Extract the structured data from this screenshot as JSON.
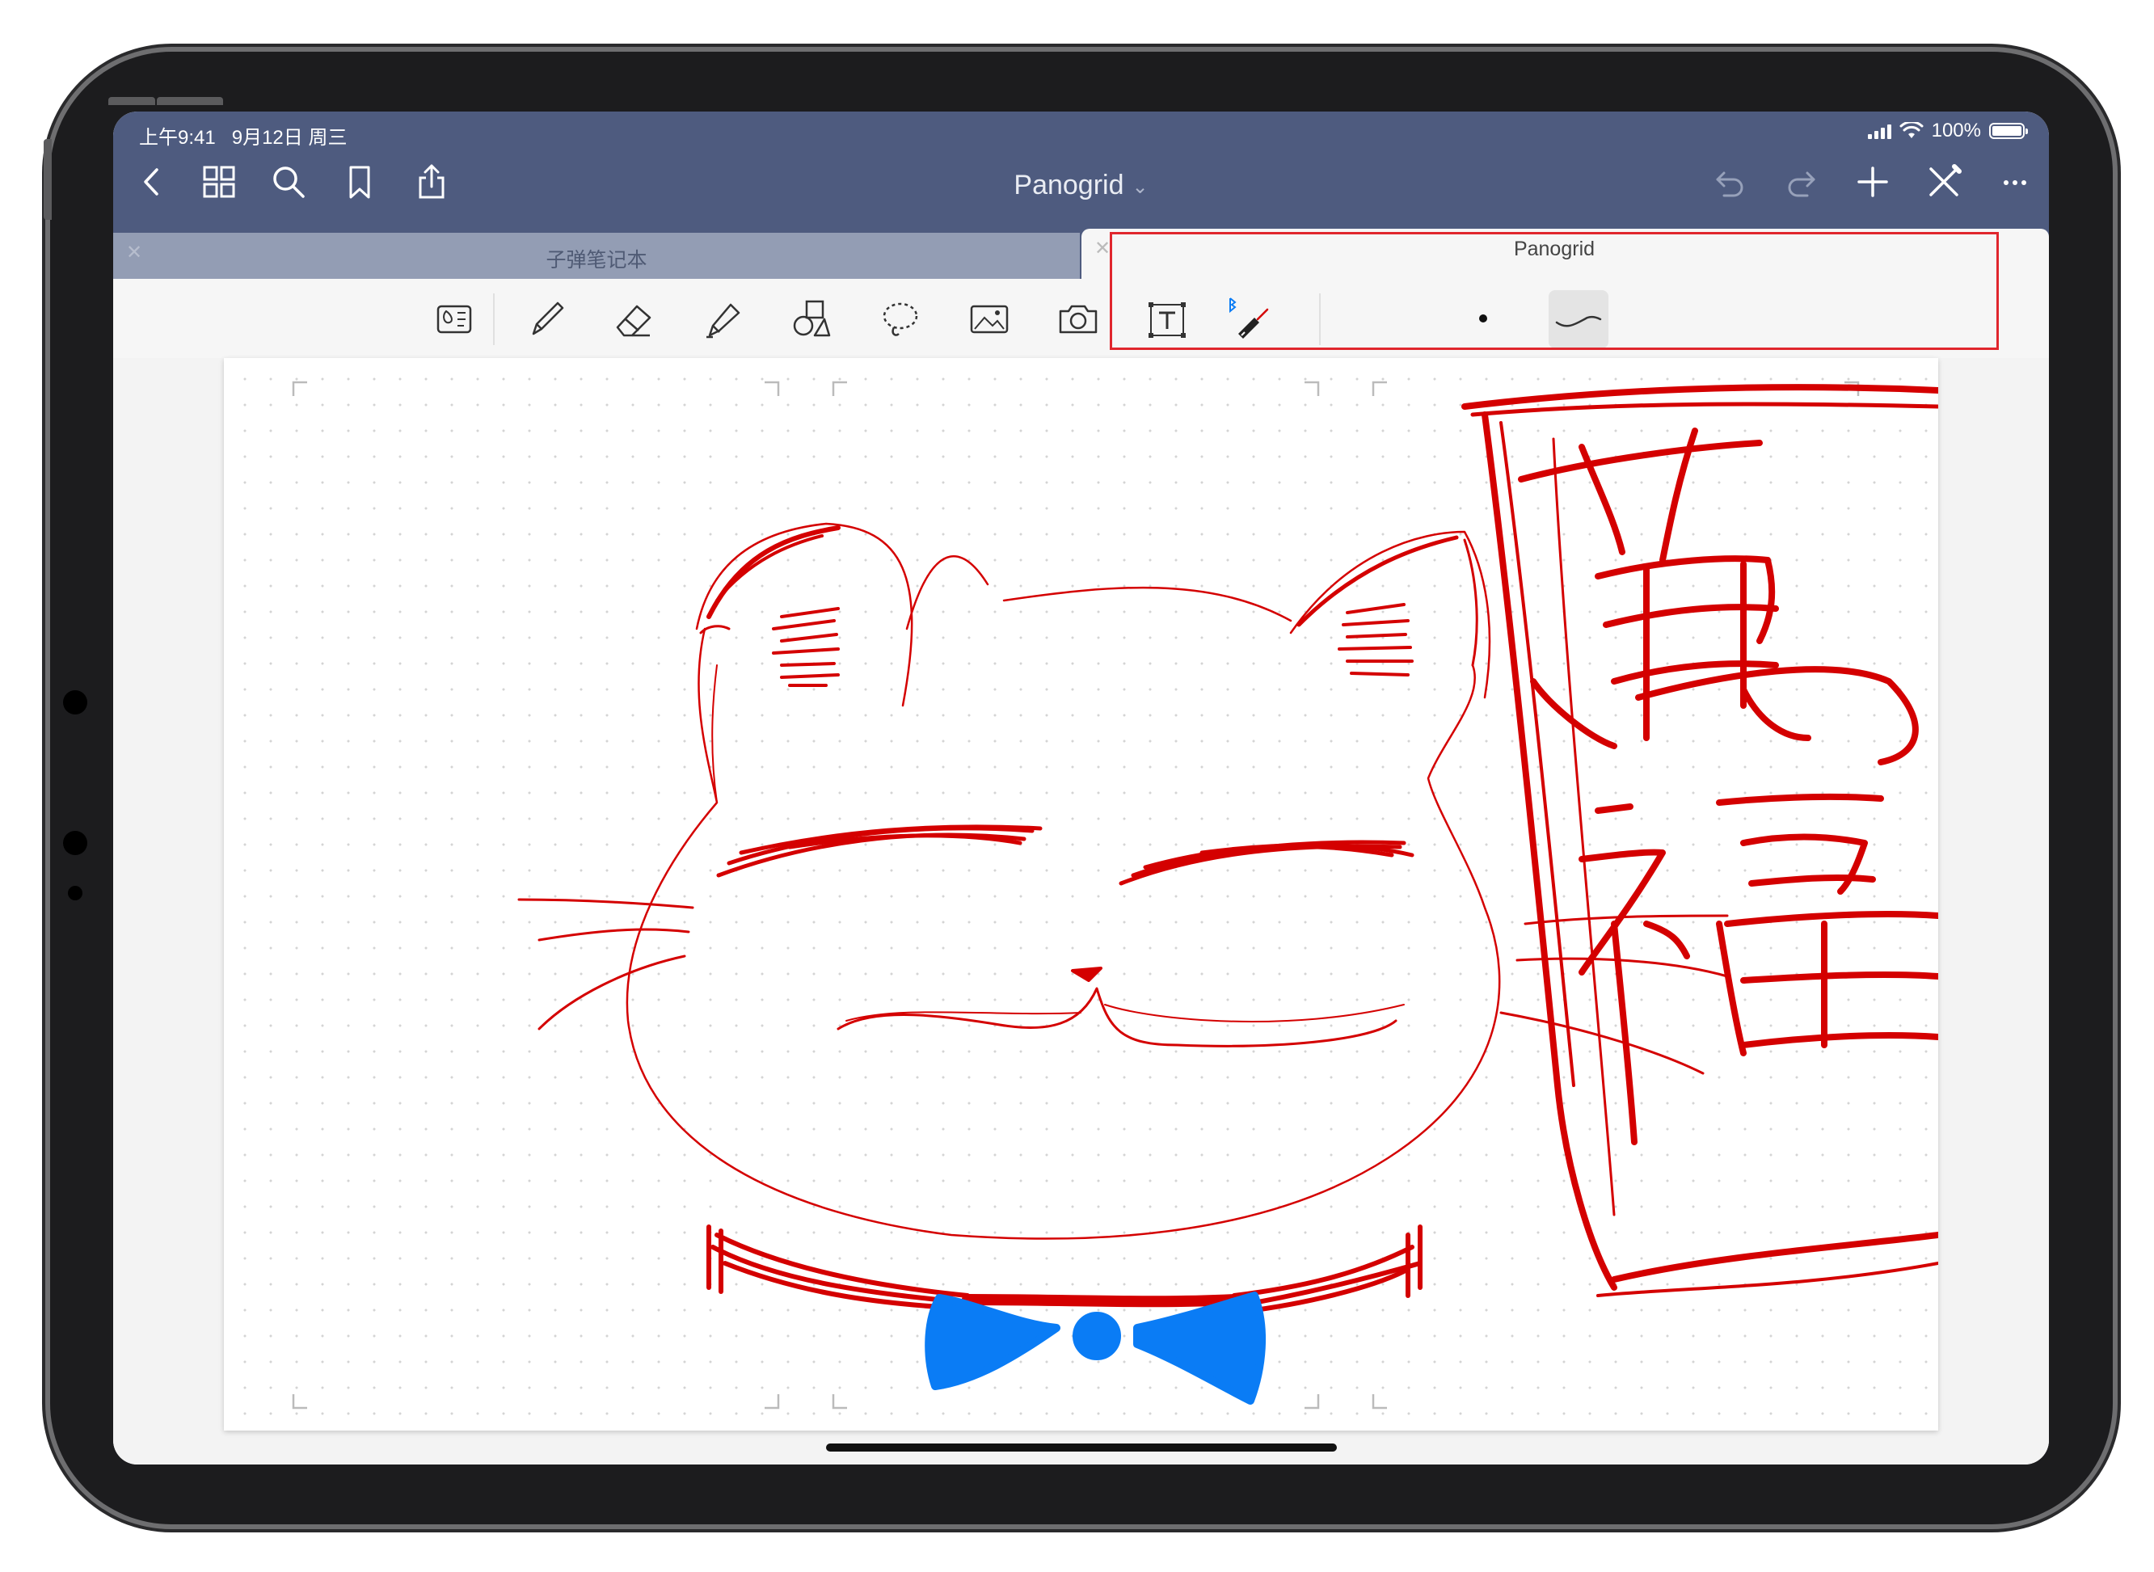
{
  "status_bar": {
    "time": "上午9:41",
    "date": "9月12日 周三",
    "battery": "100%"
  },
  "header": {
    "title": "Panogrid",
    "left_icons": [
      "back-icon",
      "grid-icon",
      "search-icon",
      "bookmark-icon",
      "share-icon"
    ],
    "right_icons": [
      "undo-icon",
      "redo-icon",
      "plus-icon",
      "close-pen-icon",
      "more-icon"
    ]
  },
  "tabs": [
    {
      "label": "子弹笔记本",
      "active": false
    },
    {
      "label": "Panogrid",
      "active": true
    }
  ],
  "toolbar": {
    "tools": [
      "read-mode-icon",
      "pen-icon",
      "eraser-icon",
      "highlighter-icon",
      "shapes-icon",
      "lasso-icon",
      "image-icon",
      "camera-icon",
      "text-icon",
      "bluetooth-pen-icon"
    ],
    "selected_stroke": "curve-stroke-icon"
  },
  "colors": {
    "header": "#4e5b7f",
    "ink_red": "#d40000",
    "ink_blue": "#0a7cf5",
    "highlight_box": "#e0262d"
  },
  "canvas": {
    "drawing": "red cat face with blue bow tie and handwritten characters",
    "characters": [
      "萬",
      "福"
    ]
  }
}
